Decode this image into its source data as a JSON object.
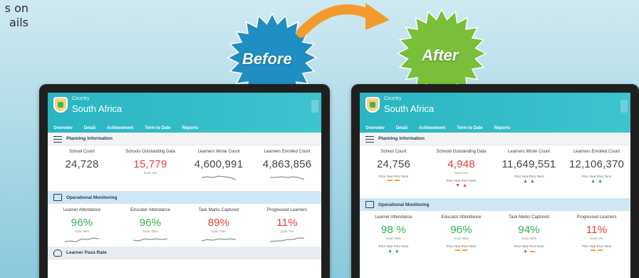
{
  "edge_text": "s on\nails",
  "badges": {
    "before": {
      "label": "Before",
      "color": "#1f8ec2"
    },
    "after": {
      "label": "After",
      "color": "#79bf3a"
    },
    "arrow_color": "#f39a2b"
  },
  "dashboard": {
    "country_label": "Country",
    "country_name": "South Africa",
    "tabs": [
      "Overview",
      "Detail",
      "Achievement",
      "Term to Date",
      "Reports"
    ],
    "sections": {
      "planning": "Planning Information",
      "operational": "Operational Monitoring",
      "pass_rate": "Learner Pass Rate"
    },
    "planning_labels": [
      "School Count",
      "Schools Outstanding Data",
      "Learners Wrote Count",
      "Learners Enrolled Count"
    ],
    "operational_labels": [
      "Learner Attendance",
      "Educator Attendance",
      "Task Marks Captured",
      "Progressed Learners"
    ],
    "prior_label": "Prior Year   Prior Term"
  },
  "before": {
    "planning": [
      {
        "value": "24,728"
      },
      {
        "value": "15,779",
        "goal": "Goal: 0%"
      },
      {
        "value": "4,600,991"
      },
      {
        "value": "4,863,856"
      }
    ],
    "operational": [
      {
        "value": "96%",
        "goal": "Goal: 95%"
      },
      {
        "value": "96%",
        "goal": "Goal: 95%"
      },
      {
        "value": "89%",
        "goal": "Goal: 90%"
      },
      {
        "value": "11%",
        "goal": "Goal: 0%"
      }
    ]
  },
  "after": {
    "planning": [
      {
        "value": "24,756"
      },
      {
        "value": "4,948",
        "goal": "Goal: 0%"
      },
      {
        "value": "11,649,551"
      },
      {
        "value": "12,106,370"
      }
    ],
    "operational": [
      {
        "value": "98 %",
        "goal": "Goal: 95%"
      },
      {
        "value": "96%",
        "goal": "Goal: 95%"
      },
      {
        "value": "94%",
        "goal": "Goal: 90%"
      },
      {
        "value": "11%",
        "goal": "Goal: 0%"
      }
    ]
  }
}
